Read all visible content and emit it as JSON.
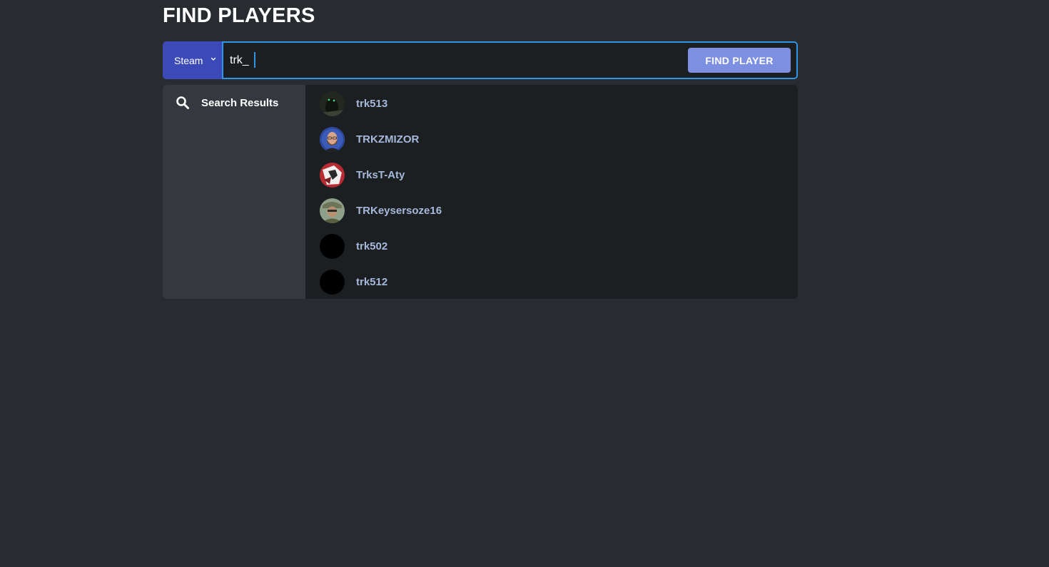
{
  "page": {
    "title": "FIND PLAYERS"
  },
  "search": {
    "platform": "Steam",
    "query": "trk_",
    "button_label": "FIND PLAYER"
  },
  "results": {
    "header": "Search Results",
    "header_icon": "search-icon",
    "players": [
      {
        "name": "trk513",
        "avatar": "dark-green-figure-avatar"
      },
      {
        "name": "TRKZMIZOR",
        "avatar": "bearded-man-avatar"
      },
      {
        "name": "TrksT-Aty",
        "avatar": "red-white-emblem-avatar"
      },
      {
        "name": "TRKeysersoze16",
        "avatar": "soldier-photo-avatar"
      },
      {
        "name": "trk502",
        "avatar": "black-default-avatar"
      },
      {
        "name": "trk512",
        "avatar": "black-default-avatar"
      }
    ]
  },
  "colors": {
    "background": "#282b30",
    "platform_select": "#3c4ab7",
    "input_border": "#2f96e6",
    "button": "#7d8fe0",
    "sidebar": "#35383e",
    "list": "#1c1f22",
    "player_name": "#a6b9da"
  }
}
